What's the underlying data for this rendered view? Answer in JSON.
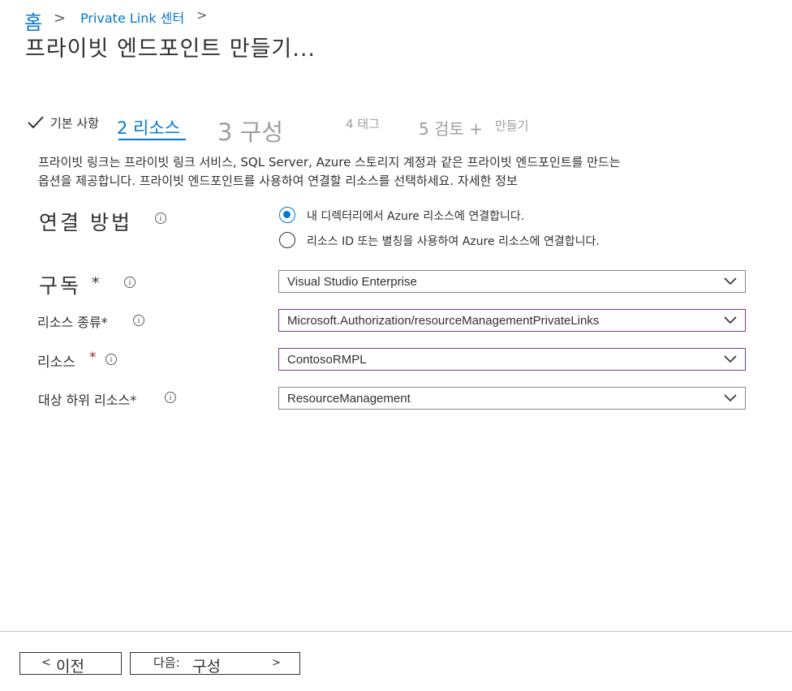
{
  "breadcrumb": {
    "home": "홈",
    "sep": ">",
    "link": "Private Link 센터",
    "sep2": ">"
  },
  "page_title": "프라이빗 엔드포인트 만들기...",
  "tabs": {
    "tab1": "기본 사항",
    "tab2": "2 리소스",
    "tab3": "3 구성",
    "tab4": "4 태그",
    "tab5a": "5 검토 +",
    "tab5b": "만들기"
  },
  "description": {
    "line1": "프라이빗 링크는 프라이빗 링크 서비스, SQL Server, Azure 스토리지 계정과 같은 프라이빗 엔드포인트를 만드는",
    "line2": "옵션을 제공합니다. 프라이빗 엔드포인트를 사용하여 연결할 리소스를 선택하세요.",
    "link": "자세한 정보"
  },
  "connection": {
    "label": "연결 방법",
    "option1": "내 디렉터리에서 Azure 리소스에 연결합니다.",
    "option2": "리소스 ID 또는 별칭을 사용하여 Azure 리소스에 연결합니다.",
    "selected": "option1"
  },
  "fields": {
    "subscription": {
      "label": "구독",
      "required": "*",
      "value": "Visual Studio Enterprise"
    },
    "resource_type": {
      "label": "리소스 종류*",
      "value": "Microsoft.Authorization/resourceManagementPrivateLinks"
    },
    "resource": {
      "label": "리소스",
      "required": "*",
      "value": "ContosoRMPL"
    },
    "target_subresource": {
      "label": "대상 하위 리소스*",
      "value": "ResourceManagement"
    }
  },
  "info_glyph": "i",
  "footer": {
    "prev_arrow": "<",
    "prev_label": "이전",
    "next_label1": "다음:",
    "next_label2": "구성",
    "next_arrow": ">"
  },
  "colors": {
    "accent": "#0078d4",
    "disabled": "#a19f9d",
    "required": "#a4262c",
    "focus_border": "#7a3b8f"
  }
}
